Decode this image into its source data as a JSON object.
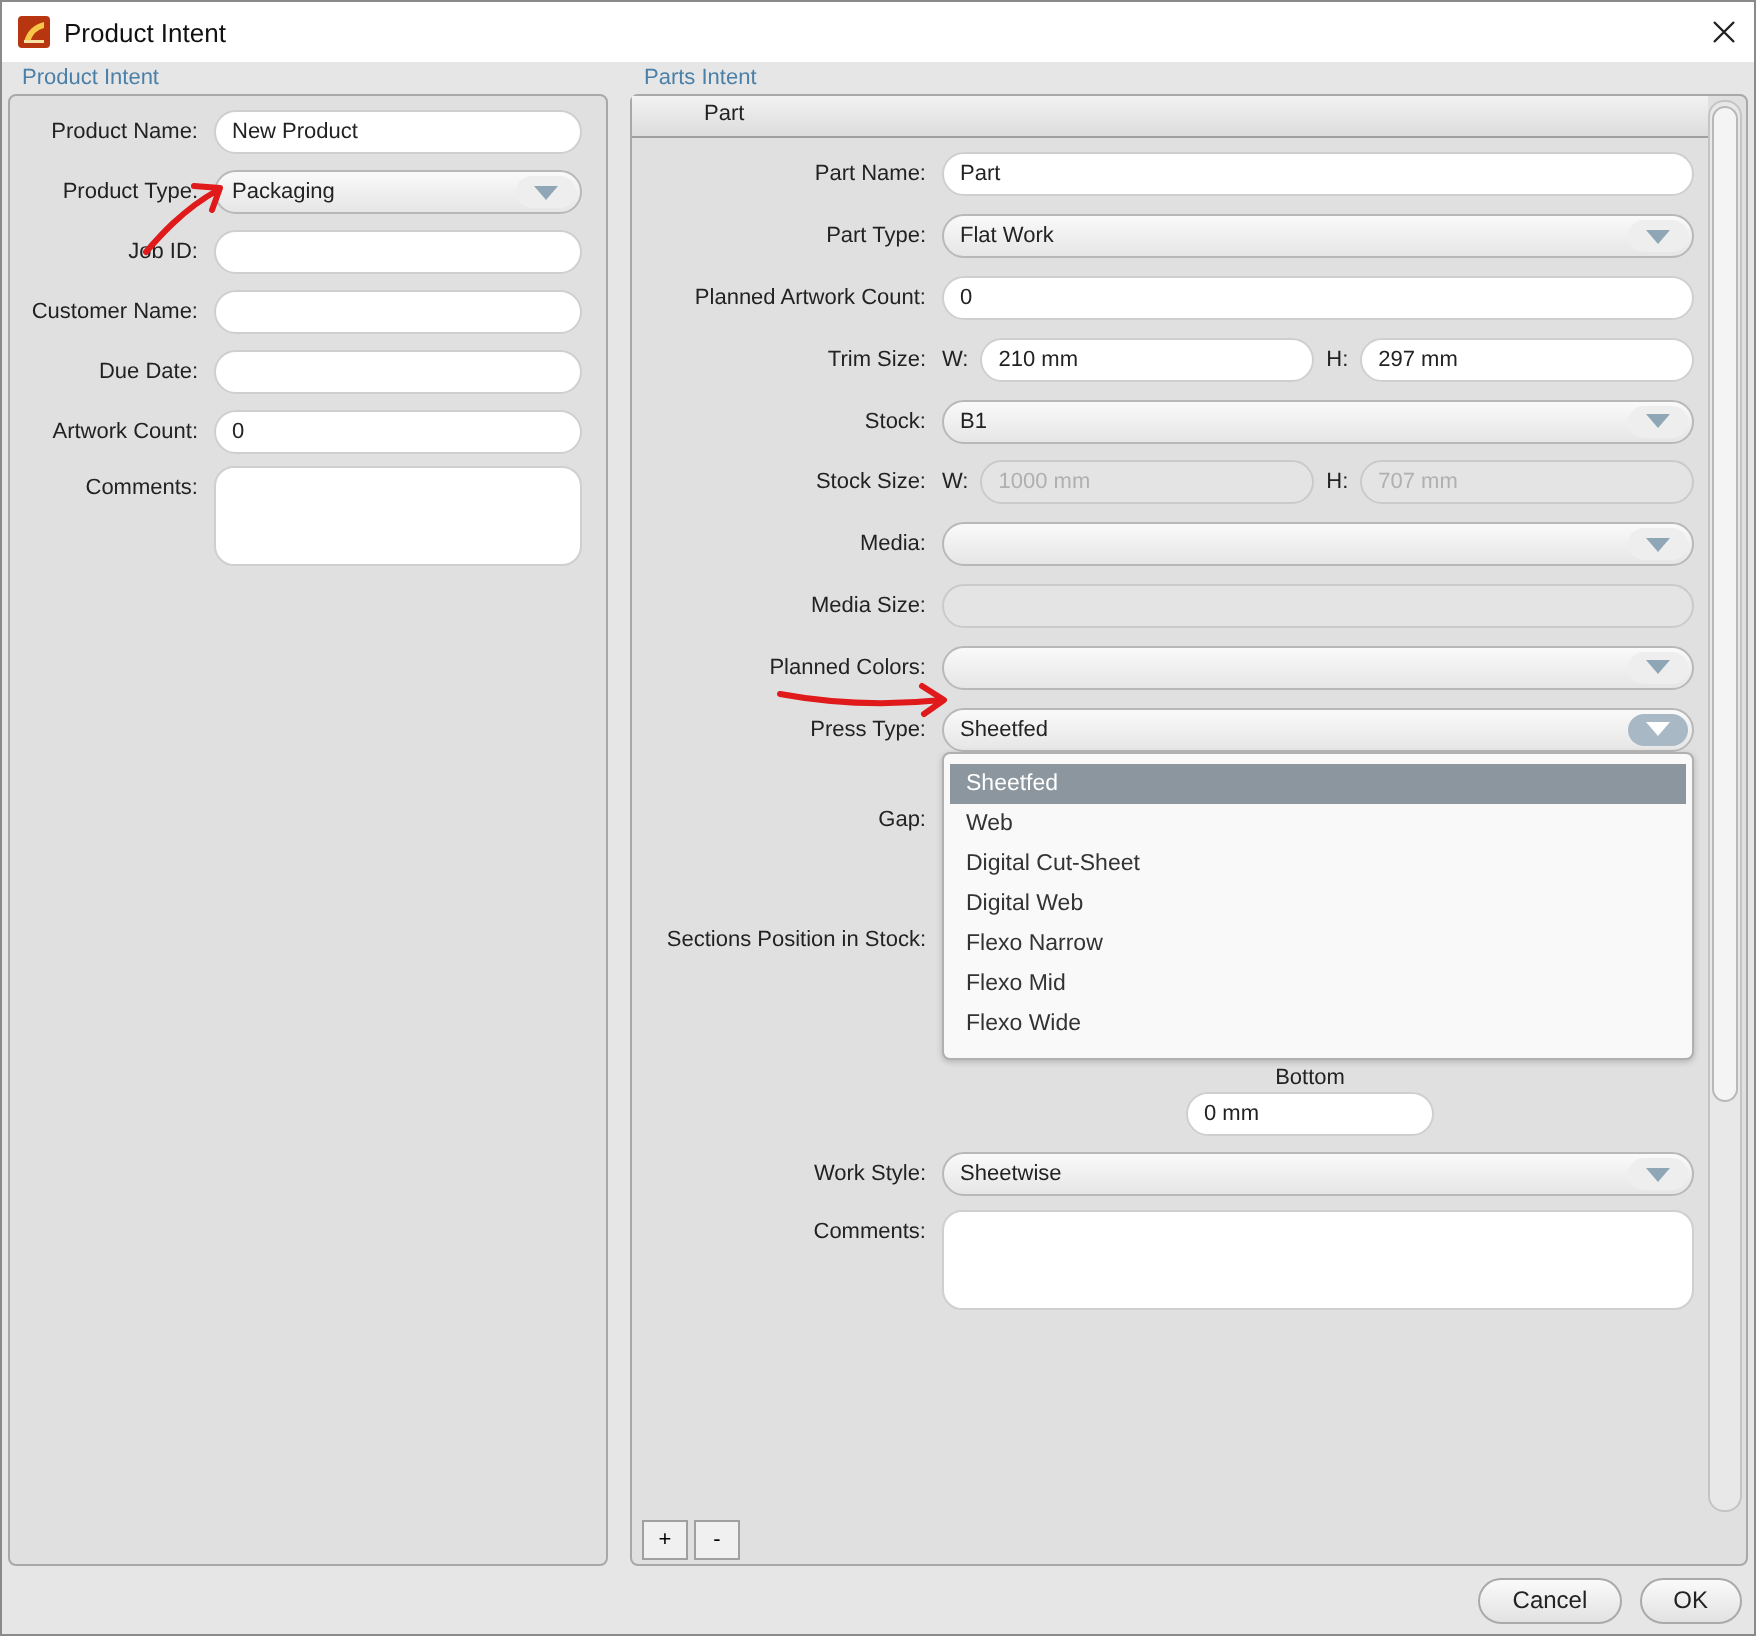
{
  "window": {
    "title": "Product Intent"
  },
  "product_intent": {
    "heading": "Product Intent",
    "fields": [
      {
        "kind": "text",
        "label": "Product Name:",
        "value": "New Product",
        "disabled": false
      },
      {
        "kind": "select",
        "label": "Product Type:",
        "value": "Packaging",
        "open": false
      },
      {
        "kind": "text",
        "label": "Job ID:",
        "disabled": false
      },
      {
        "kind": "text",
        "label": "Customer Name:",
        "disabled": false
      },
      {
        "kind": "text",
        "label": "Due Date:",
        "disabled": false
      },
      {
        "kind": "text",
        "label": "Artwork Count:",
        "value": "0",
        "disabled": false
      },
      {
        "kind": "textarea",
        "label": "Comments:",
        "disabled": false
      }
    ]
  },
  "parts_intent": {
    "heading": "Parts Intent",
    "tabs": [
      {
        "label": "Part",
        "selected": true
      }
    ],
    "fields": [
      {
        "kind": "text",
        "label": "Part Name:",
        "value": "Part",
        "disabled": false
      },
      {
        "kind": "select",
        "label": "Part Type:",
        "value": "Flat Work",
        "open": false
      },
      {
        "kind": "text",
        "label": "Planned Artwork Count:",
        "value": "0",
        "disabled": false
      },
      {
        "kind": "pair",
        "label": "Trim Size:",
        "w_label": "W:",
        "w_value": "210 mm",
        "h_label": "H:",
        "h_value": "297 mm",
        "disabled": false
      },
      {
        "kind": "select",
        "label": "Stock:",
        "value": "B1",
        "open": false
      },
      {
        "kind": "pair",
        "label": "Stock Size:",
        "w_label": "W:",
        "w_value": "1000 mm",
        "h_label": "H:",
        "h_value": "707 mm",
        "disabled": true
      },
      {
        "kind": "select",
        "label": "Media:",
        "open": false
      },
      {
        "kind": "text",
        "label": "Media Size:",
        "disabled": true
      },
      {
        "kind": "select",
        "label": "Planned Colors:",
        "open": false
      },
      {
        "kind": "select",
        "label": "Press Type:",
        "value": "Sheetfed",
        "open": true,
        "options": [
          {
            "label": "Sheetfed",
            "selected": true
          },
          {
            "label": "Web",
            "selected": false
          },
          {
            "label": "Digital Cut-Sheet",
            "selected": false
          },
          {
            "label": "Digital Web",
            "selected": false
          },
          {
            "label": "Flexo Narrow",
            "selected": false
          },
          {
            "label": "Flexo Mid",
            "selected": false
          },
          {
            "label": "Flexo Wide",
            "selected": false
          }
        ]
      },
      {
        "kind": "label_only",
        "label": "Gap:"
      },
      {
        "kind": "label_only",
        "label": "Sections Position in Stock:"
      },
      {
        "kind": "captioned",
        "caption": "Bottom",
        "value": "0 mm",
        "disabled": false
      },
      {
        "kind": "select",
        "label": "Work Style:",
        "value": "Sheetwise",
        "open": false
      },
      {
        "kind": "textarea",
        "label": "Comments:",
        "disabled": false
      }
    ],
    "buttons": [
      "+",
      "-"
    ]
  },
  "buttons": [
    "Cancel",
    "OK"
  ]
}
